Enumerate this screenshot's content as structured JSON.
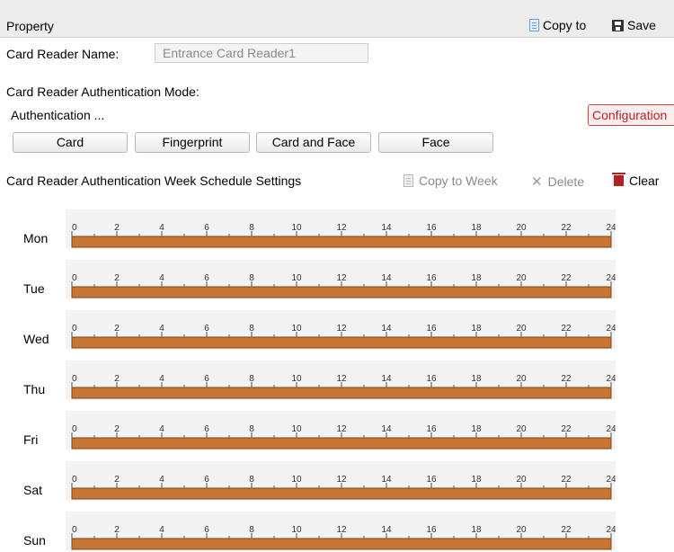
{
  "header": {
    "title": "Property",
    "copy_to_label": "Copy to",
    "save_label": "Save"
  },
  "card_reader": {
    "name_label": "Card Reader Name:",
    "name_value": "Entrance Card Reader1"
  },
  "auth_mode": {
    "section_label": "Card Reader Authentication Mode:",
    "auth_label": "Authentication ...",
    "configuration_label": "Configuration",
    "modes": [
      "Card",
      "Fingerprint",
      "Card and Face",
      "Face"
    ]
  },
  "schedule": {
    "title": "Card Reader Authentication Week Schedule Settings",
    "copy_to_week_label": "Copy to Week",
    "delete_label": "Delete",
    "clear_label": "Clear",
    "hour_labels": [
      "0",
      "2",
      "4",
      "6",
      "8",
      "10",
      "12",
      "14",
      "16",
      "18",
      "20",
      "22",
      "24"
    ],
    "days": [
      "Mon",
      "Tue",
      "Wed",
      "Thu",
      "Fri",
      "Sat",
      "Sun"
    ],
    "bar_color": "#c87432",
    "coverage_hours": [
      0,
      24
    ]
  }
}
